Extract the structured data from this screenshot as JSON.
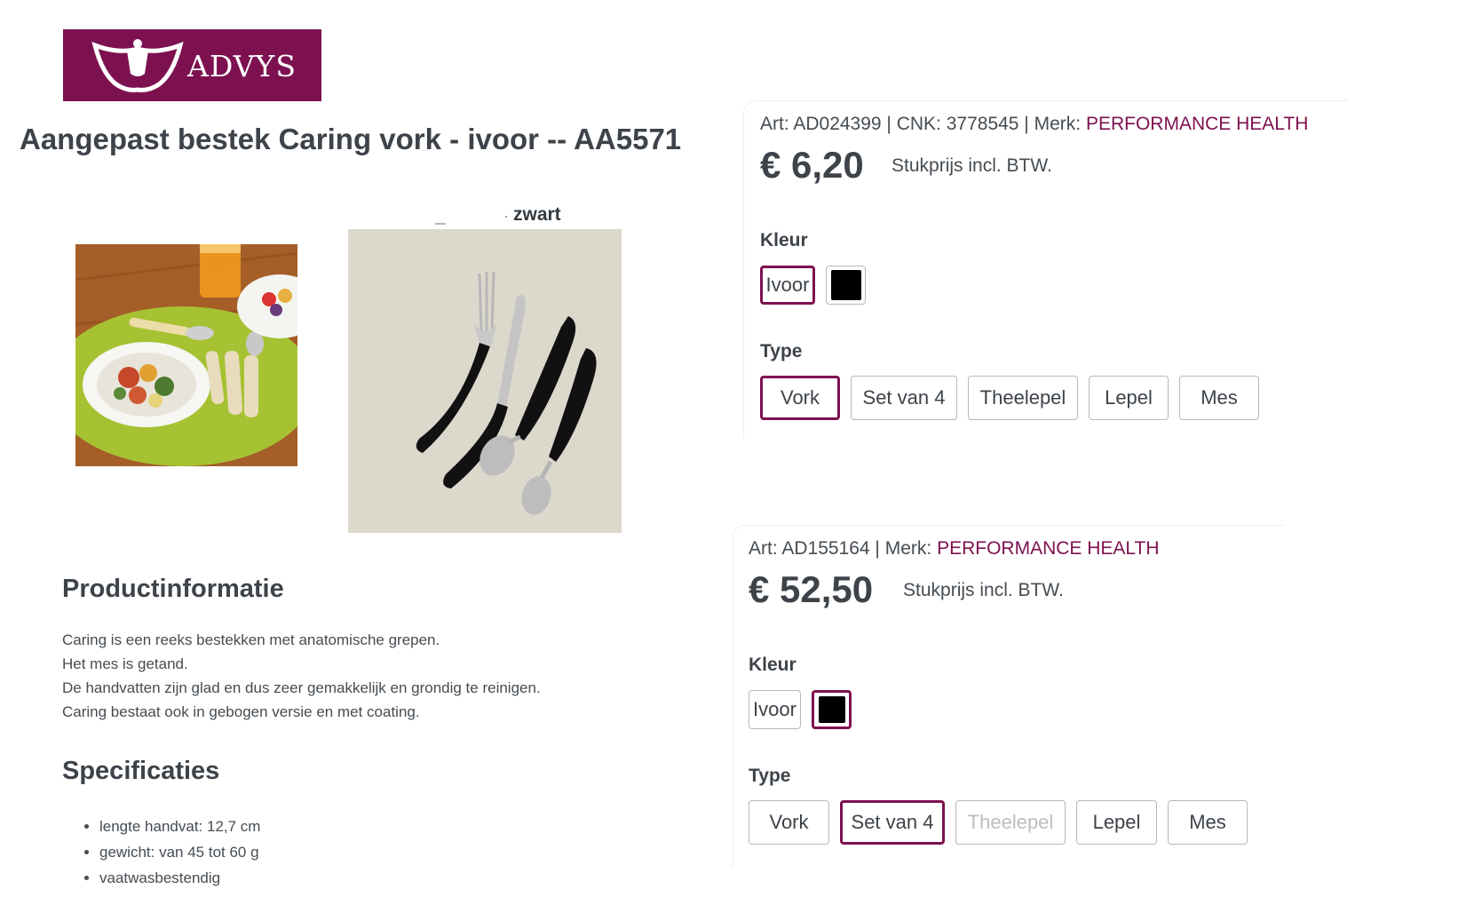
{
  "brand": {
    "logo_text": "ADVYS",
    "color": "#7d1150"
  },
  "product": {
    "title": "Aangepast bestek Caring vork - ivoor -- AA5571",
    "image_caption": "zwart"
  },
  "info": {
    "heading": "Productinformatie",
    "lines": [
      "Caring is een reeks bestekken met anatomische grepen.",
      "Het mes is getand.",
      "De handvatten zijn glad en dus zeer gemakkelijk en grondig te reinigen.",
      "Caring bestaat ook in gebogen versie en met coating."
    ]
  },
  "specs": {
    "heading": "Specificaties",
    "items": [
      "lengte handvat: 12,7 cm",
      "gewicht: van 45 tot 60 g",
      "vaatwasbestendig"
    ]
  },
  "variant1": {
    "meta": "Art: AD024399 | CNK: 3778545 | Merk:",
    "brand": "PERFORMANCE HEALTH",
    "price": "€ 6,20",
    "unit": "Stukprijs incl. BTW.",
    "color_label": "Kleur",
    "colors": [
      {
        "label": "Ivoor",
        "selected": true
      },
      {
        "swatch": "#000000",
        "selected": false
      }
    ],
    "type_label": "Type",
    "types": [
      {
        "label": "Vork",
        "selected": true
      },
      {
        "label": "Set van 4"
      },
      {
        "label": "Theelepel"
      },
      {
        "label": "Lepel"
      },
      {
        "label": "Mes"
      }
    ]
  },
  "variant2": {
    "meta": "Art: AD155164 | Merk:",
    "brand": "PERFORMANCE HEALTH",
    "price": "€ 52,50",
    "unit": "Stukprijs incl. BTW.",
    "color_label": "Kleur",
    "colors": [
      {
        "label": "Ivoor",
        "selected": false
      },
      {
        "swatch": "#000000",
        "selected": true
      }
    ],
    "type_label": "Type",
    "types": [
      {
        "label": "Vork"
      },
      {
        "label": "Set van 4",
        "selected": true
      },
      {
        "label": "Theelepel",
        "disabled": true
      },
      {
        "label": "Lepel"
      },
      {
        "label": "Mes"
      }
    ]
  }
}
